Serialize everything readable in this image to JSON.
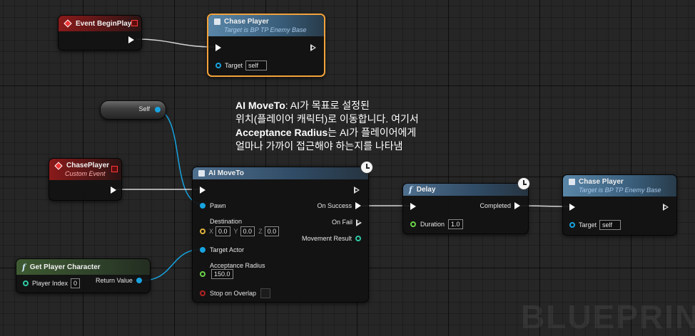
{
  "watermark": "BLUEPRINT",
  "comment": {
    "line1_bold": "AI MoveTo",
    "line1_rest": ": AI가 목표로 설정된",
    "line2": "위치(플레이어 캐릭터)로 이동합니다. 여기서",
    "line3_bold": "Acceptance Radius",
    "line3_rest": "는 AI가 플레이어에게",
    "line4": "얼마나 가까이 접근해야 하는지를 나타냄"
  },
  "nodes": {
    "event_begin_play": {
      "title": "Event BeginPlay"
    },
    "chase_player_top": {
      "title": "Chase Player",
      "subtitle": "Target is BP TP Enemy Base",
      "target_label": "Target",
      "target_value": "self"
    },
    "self_ref": {
      "label": "Self"
    },
    "custom_event": {
      "title": "ChasePlayer",
      "subtitle": "Custom Event"
    },
    "get_player_character": {
      "title": "Get Player Character",
      "player_index_label": "Player Index",
      "player_index_value": "0",
      "return_label": "Return Value"
    },
    "ai_move_to": {
      "title": "AI MoveTo",
      "pawn": "Pawn",
      "destination": "Destination",
      "x_label": "X",
      "x_value": "0.0",
      "y_label": "Y",
      "y_value": "0.0",
      "z_label": "Z",
      "z_value": "0.0",
      "target_actor": "Target Actor",
      "acceptance_radius": "Acceptance Radius",
      "acceptance_radius_value": "150.0",
      "stop_on_overlap": "Stop on Overlap",
      "on_success": "On Success",
      "on_fail": "On Fail",
      "movement_result": "Movement Result"
    },
    "delay": {
      "title": "Delay",
      "completed": "Completed",
      "duration_label": "Duration",
      "duration_value": "1.0"
    },
    "chase_player_right": {
      "title": "Chase Player",
      "subtitle": "Target is BP TP Enemy Base",
      "target_label": "Target",
      "target_value": "self"
    }
  },
  "colors": {
    "exec_wire": "#d8d8d8",
    "object_wire": "#17a3e0",
    "selection": "#f2a23a"
  }
}
